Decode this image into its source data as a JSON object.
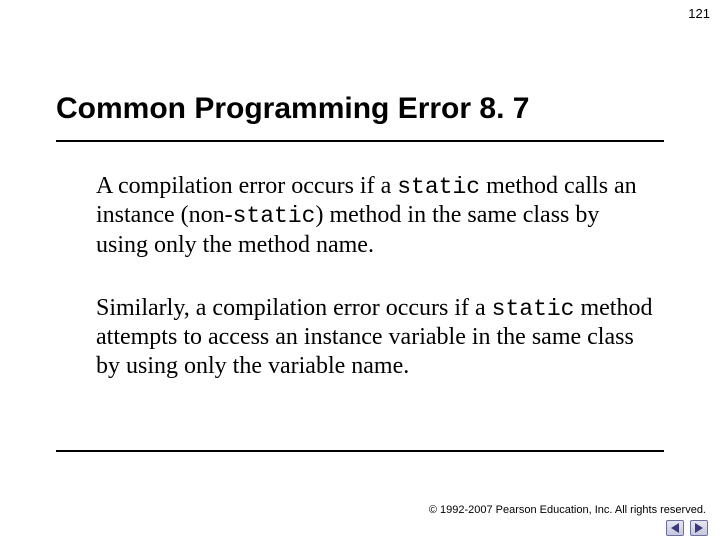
{
  "page_number": "121",
  "title": "Common Programming Error 8. 7",
  "para1": {
    "t1": "A compilation error occurs if a ",
    "c1": "static",
    "t2": " method calls an instance (non-",
    "c2": "static",
    "t3": ") method in the same class by using only the method name."
  },
  "para2": {
    "t1": "Similarly, a compilation error occurs if a ",
    "c1": "static",
    "t2": " method attempts to access an instance variable in the same class by using only the variable name."
  },
  "footer": {
    "copyright_symbol": "©",
    "text": " 1992-2007 Pearson Education, Inc.  All rights reserved."
  },
  "nav": {
    "prev": "prev-slide",
    "next": "next-slide"
  }
}
